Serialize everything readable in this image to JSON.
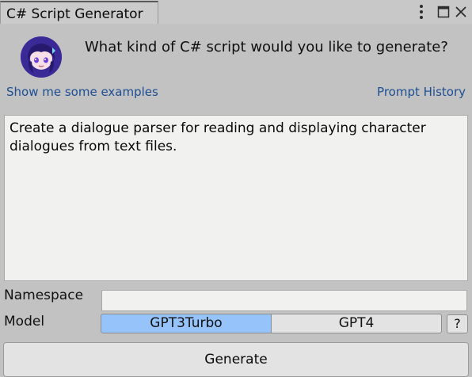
{
  "window": {
    "tab_title": "C# Script Generator",
    "icons": [
      "kebab-menu-icon",
      "maximize-icon",
      "close-icon"
    ]
  },
  "header": {
    "avatar_icon": "anime-character-avatar-icon",
    "question": "What kind of C# script would you like to generate?"
  },
  "links": {
    "examples": "Show me some examples",
    "history": "Prompt History"
  },
  "prompt": {
    "text": "Create a dialogue parser for reading and displaying character dialogues from text files."
  },
  "namespace": {
    "label": "Namespace",
    "value": ""
  },
  "model": {
    "label": "Model",
    "options": [
      "GPT3Turbo",
      "GPT4"
    ],
    "selected": "GPT3Turbo",
    "help_label": "?"
  },
  "actions": {
    "generate_label": "Generate"
  },
  "colors": {
    "selected_model": "#96c3fa",
    "link": "#1d4f94",
    "panel_bg": "#c2c2c2"
  }
}
